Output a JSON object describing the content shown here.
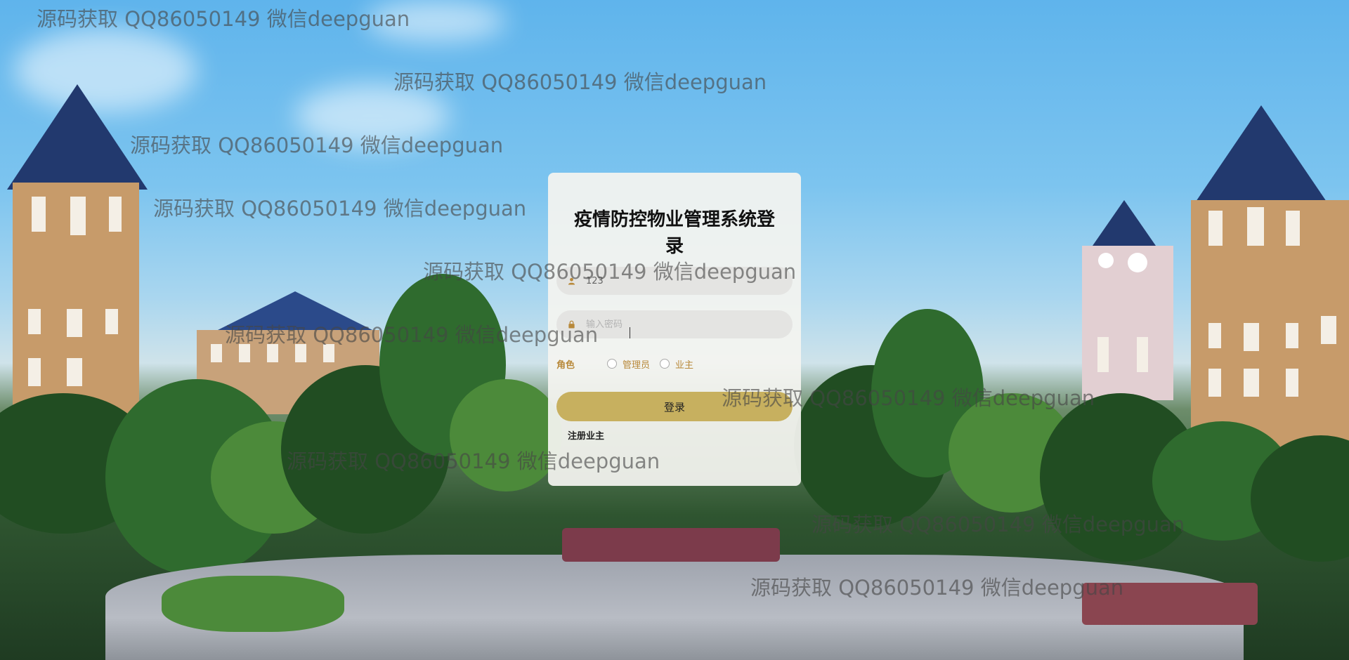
{
  "login": {
    "title": "疫情防控物业管理系统登录",
    "username_value": "123",
    "password_placeholder": "输入密码",
    "role_label": "角色",
    "roles": [
      "管理员",
      "业主"
    ],
    "login_button": "登录",
    "register_link": "注册业主"
  },
  "watermarks": [
    "源码获取 QQ86050149 微信deepguan",
    "源码获取 QQ86050149 微信deepguan",
    "源码获取 QQ86050149 微信deepguan",
    "源码获取 QQ86050149 微信deepguan",
    "源码获取 QQ86050149 微信deepguan",
    "源码获取 QQ86050149 微信deepguan",
    "源码获取 QQ86050149 微信deepguan",
    "源码获取 QQ86050149 微信deepguan",
    "源码获取 QQ86050149 微信deepguan",
    "源码获取 QQ86050149 微信deepguan"
  ],
  "icons": {
    "user": "user-icon",
    "lock": "lock-icon"
  },
  "colors": {
    "accent": "#c7b05f",
    "role_text": "#b8893a"
  }
}
